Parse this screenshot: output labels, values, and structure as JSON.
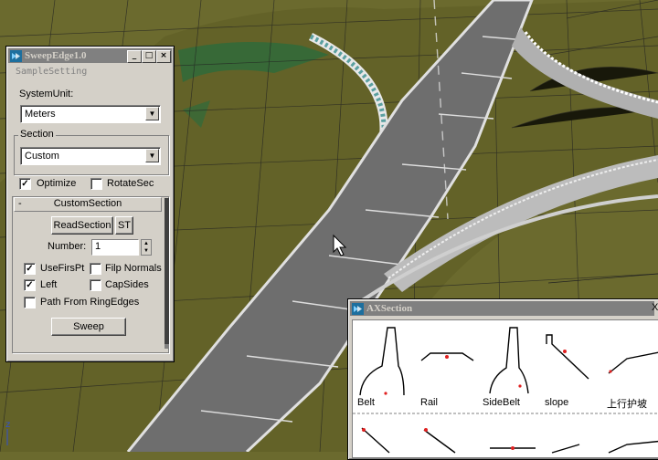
{
  "sweep_window": {
    "title": "SweepEdge1.0",
    "subtitle": "SampleSetting",
    "system_unit_label": "SystemUnit:",
    "system_unit_value": "Meters",
    "section_group_label": "Section",
    "section_value": "Custom",
    "optimize_label": "Optimize",
    "optimize_checked": true,
    "rotate_sec_label": "RotateSec",
    "rotate_sec_checked": false,
    "rollout_toggle": "-",
    "rollout_title": "CustomSection",
    "read_section_label": "ReadSection",
    "st_label": "ST",
    "number_label": "Number:",
    "number_value": "1",
    "use_first_pt_label": "UseFirsPt",
    "use_first_pt_checked": true,
    "flip_normals_label": "Filp Normals",
    "flip_normals_checked": false,
    "left_label": "Left",
    "left_checked": true,
    "cap_sides_label": "CapSides",
    "cap_sides_checked": false,
    "path_from_ring_label": "Path From RingEdges",
    "path_from_ring_checked": false,
    "sweep_label": "Sweep",
    "minimize_glyph": "_",
    "maximize_glyph": "□",
    "close_glyph": "×"
  },
  "ax_window": {
    "title": "AXSection",
    "close_glyph": "X",
    "items": [
      {
        "label": "Belt"
      },
      {
        "label": "Rail"
      },
      {
        "label": "SideBelt"
      },
      {
        "label": "slope"
      },
      {
        "label": "上行护坡"
      }
    ]
  },
  "viewport": {
    "axis_label": "z",
    "ground_color": "#6b6a2e",
    "road_color": "#6e6e6e",
    "accent_green": "#2f6b3a"
  },
  "icons": [
    "max-app-icon",
    "check-icon",
    "dropdown-arrow-icon",
    "spinner-up-icon",
    "spinner-down-icon",
    "mouse-cursor-icon"
  ]
}
